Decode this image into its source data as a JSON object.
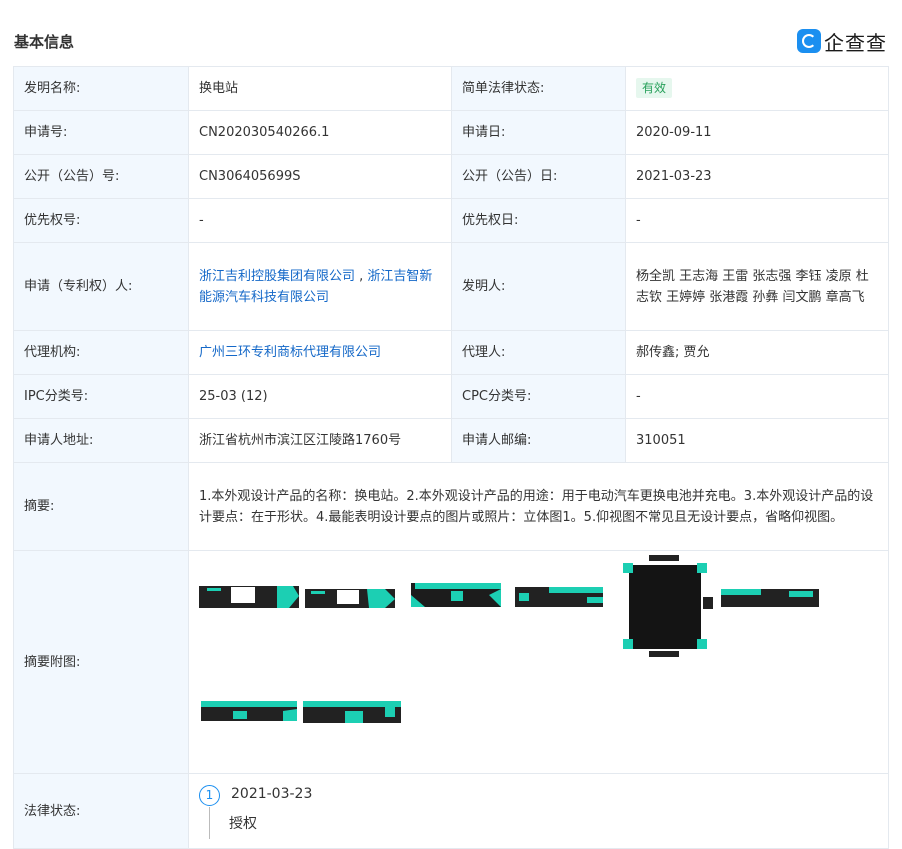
{
  "header": {
    "title": "基本信息",
    "logo_text": "企查查"
  },
  "rows": [
    {
      "l1": "发明名称:",
      "v1": "换电站",
      "l2": "简单法律状态:",
      "v2_badge": "有效"
    },
    {
      "l1": "申请号:",
      "v1": "CN202030540266.1",
      "l2": "申请日:",
      "v2": "2020-09-11"
    },
    {
      "l1": "公开（公告）号:",
      "v1": "CN306405699S",
      "l2": "公开（公告）日:",
      "v2": "2021-03-23"
    },
    {
      "l1": "优先权号:",
      "v1": "-",
      "l2": "优先权日:",
      "v2": "-"
    },
    {
      "l1": "申请（专利权）人:",
      "v1_link_a": "浙江吉利控股集团有限公司",
      "v1_sep": " , ",
      "v1_link_b": "浙江吉智新能源汽车科技有限公司",
      "l2": "发明人:",
      "v2": "杨全凯 王志海 王雷 张志强 李钰 凌原 杜志钦 王婷婷 张港霞 孙彝 闫文鹏 章高飞"
    },
    {
      "l1": "代理机构:",
      "v1_link": "广州三环专利商标代理有限公司",
      "l2": "代理人:",
      "v2": "郝传鑫; 贾允"
    },
    {
      "l1": "IPC分类号:",
      "v1": "25-03 (12)",
      "l2": "CPC分类号:",
      "v2": "-"
    },
    {
      "l1": "申请人地址:",
      "v1": "浙江省杭州市滨江区江陵路1760号",
      "l2": "申请人邮编:",
      "v2": "310051"
    }
  ],
  "abstract": {
    "label": "摘要:",
    "text": "1.本外观设计产品的名称：换电站。2.本外观设计产品的用途：用于电动汽车更换电池并充电。3.本外观设计产品的设计要点：在于形状。4.最能表明设计要点的图片或照片：立体图1。5.仰视图不常见且无设计要点，省略仰视图。"
  },
  "figures": {
    "label": "摘要附图:"
  },
  "legal": {
    "label": "法律状态:",
    "step": "1",
    "date": "2021-03-23",
    "event": "授权"
  },
  "colors": {
    "accent": "#1b8ff0",
    "link": "#1468c8",
    "label_bg": "#f2f8fe",
    "teal": "#1ccfb3",
    "badge_green": "#27a05a"
  }
}
